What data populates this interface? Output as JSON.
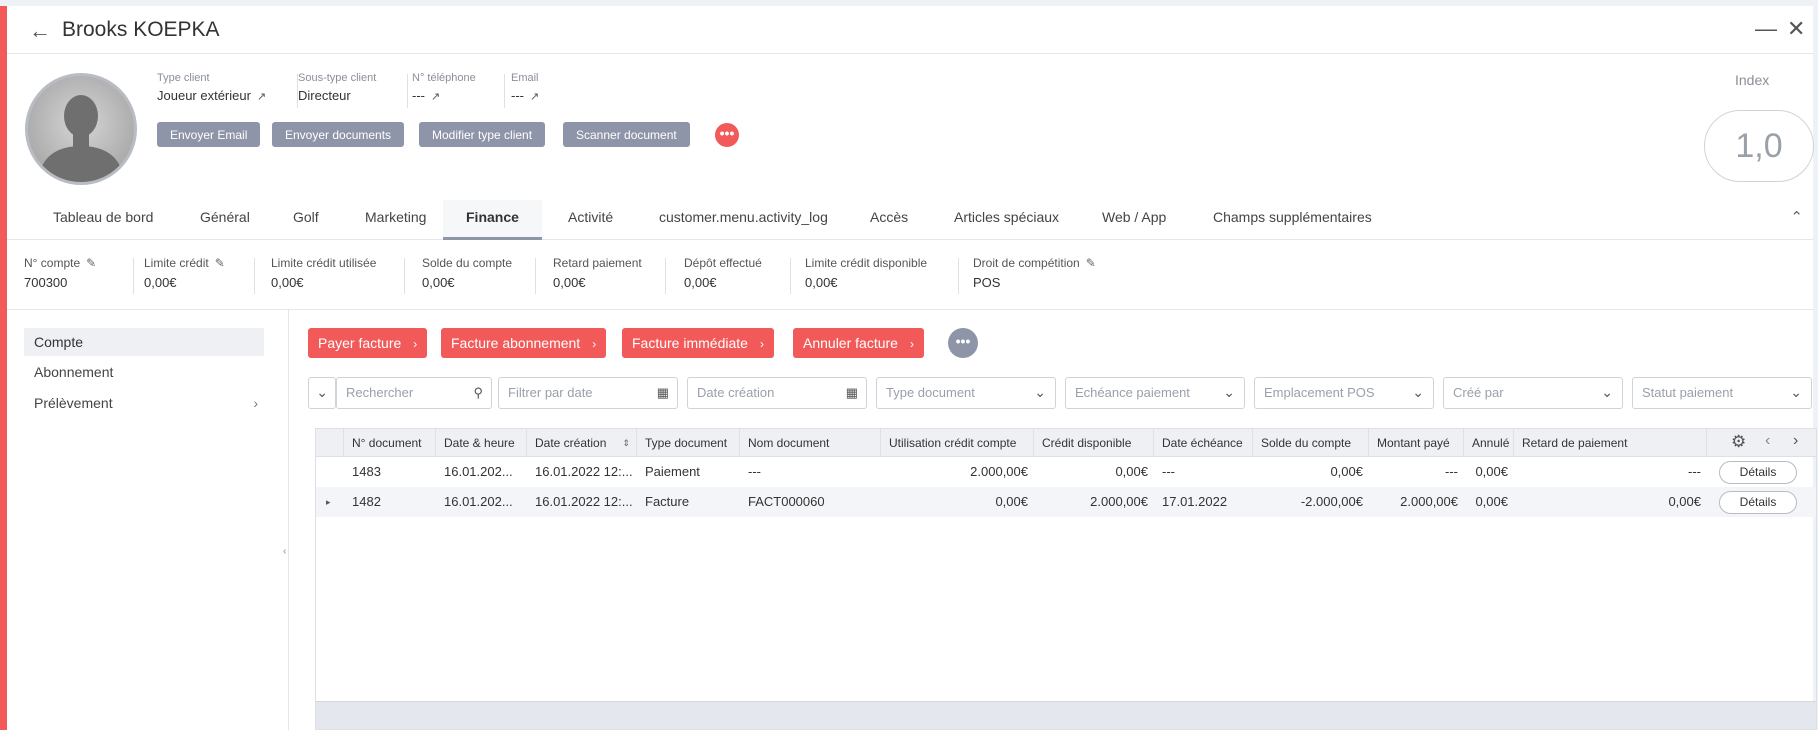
{
  "window": {
    "title": "Brooks KOEPKA",
    "back_icon": "arrow-left-icon",
    "minimize_icon": "minimize-icon",
    "close_icon": "close-icon"
  },
  "profile": {
    "fields": [
      {
        "label": "Type client",
        "value": "Joueur extérieur"
      },
      {
        "label": "Sous-type client",
        "value": "Directeur"
      },
      {
        "label": "N° téléphone",
        "value": "---"
      },
      {
        "label": "Email",
        "value": "---"
      }
    ],
    "buttons": [
      "Envoyer Email",
      "Envoyer documents",
      "Modifier type client",
      "Scanner document"
    ],
    "more_label": "•••",
    "index_label": "Index",
    "index_value": "1,0"
  },
  "tabs": [
    "Tableau de bord",
    "Général",
    "Golf",
    "Marketing",
    "Finance",
    "Activité",
    "customer.menu.activity_log",
    "Accès",
    "Articles spéciaux",
    "Web / App",
    "Champs supplémentaires"
  ],
  "active_tab": "Finance",
  "stats": [
    {
      "label": "N° compte",
      "value": "700300"
    },
    {
      "label": "Limite crédit",
      "value": "0,00€"
    },
    {
      "label": "Limite crédit utilisée",
      "value": "0,00€"
    },
    {
      "label": "Solde du compte",
      "value": "0,00€"
    },
    {
      "label": "Retard paiement",
      "value": "0,00€"
    },
    {
      "label": "Dépôt effectué",
      "value": "0,00€"
    },
    {
      "label": "Limite crédit disponible",
      "value": "0,00€"
    },
    {
      "label": "Droit de compétition",
      "value": "POS"
    }
  ],
  "sidebar": {
    "items": [
      "Compte",
      "Abonnement",
      "Prélèvement"
    ]
  },
  "actions": {
    "buttons": [
      "Payer facture",
      "Facture abonnement",
      "Facture immédiate",
      "Annuler facture"
    ],
    "more_label": "•••"
  },
  "filters": {
    "search_placeholder": "Rechercher",
    "date_filter_placeholder": "Filtrer par date",
    "creation_date_placeholder": "Date création",
    "type_document": "Type document",
    "payment_due": "Echéance paiement",
    "pos_location": "Emplacement POS",
    "created_by": "Créé par",
    "payment_status": "Statut paiement"
  },
  "table": {
    "columns": [
      "N° document",
      "Date & heure",
      "Date création",
      "Type document",
      "Nom document",
      "Utilisation crédit compte",
      "Crédit disponible",
      "Date échéance",
      "Solde du compte",
      "Montant payé",
      "Annulé",
      "Retard de paiement"
    ],
    "rows": [
      {
        "doc": "1483",
        "datetime": "16.01.202...",
        "created": "16.01.2022 12:...",
        "type": "Paiement",
        "name": "---",
        "credit_use": "2.000,00€",
        "credit_avail": "0,00€",
        "due": "---",
        "balance": "0,00€",
        "paid": "---",
        "cancelled": "0,00€",
        "late": "---",
        "details": "Détails"
      },
      {
        "doc": "1482",
        "datetime": "16.01.202...",
        "created": "16.01.2022 12:...",
        "type": "Facture",
        "name": "FACT000060",
        "credit_use": "0,00€",
        "credit_avail": "2.000,00€",
        "due": "17.01.2022",
        "balance": "-2.000,00€",
        "paid": "2.000,00€",
        "cancelled": "0,00€",
        "late": "0,00€",
        "details": "Détails"
      }
    ]
  }
}
